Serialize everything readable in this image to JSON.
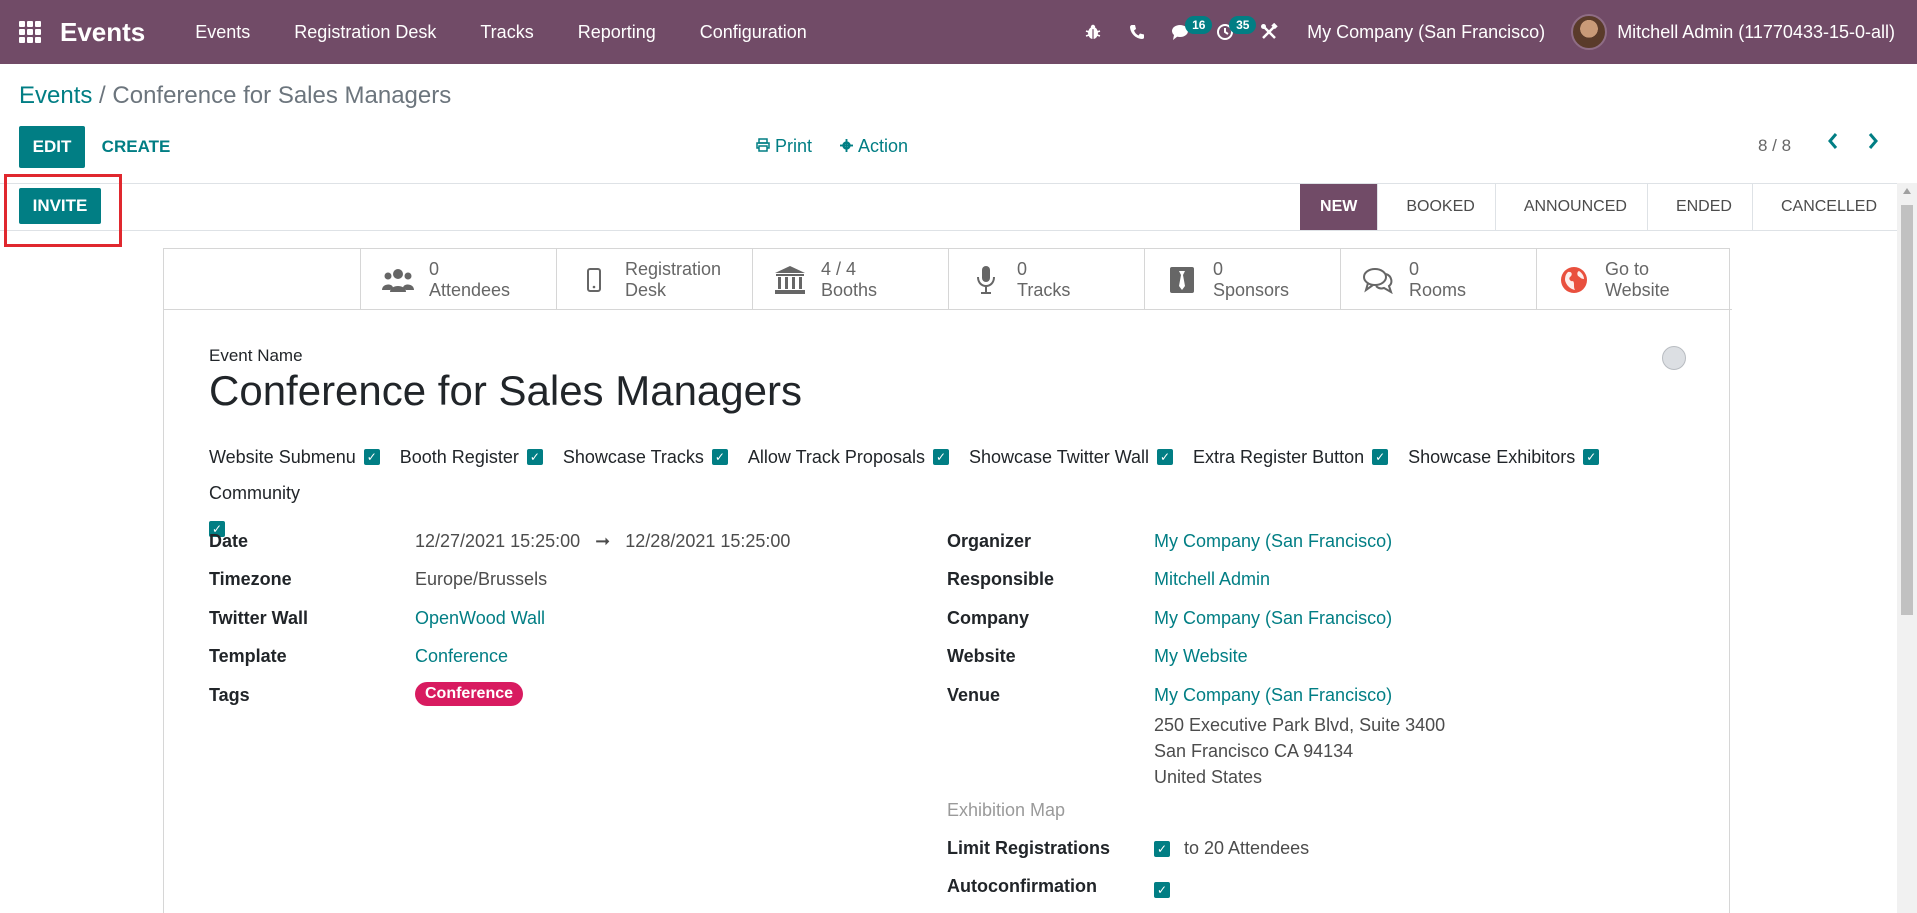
{
  "navbar": {
    "brand": "Events",
    "menu": [
      "Events",
      "Registration Desk",
      "Tracks",
      "Reporting",
      "Configuration"
    ],
    "chat_count": "16",
    "activity_count": "35",
    "company": "My Company (San Francisco)",
    "user": "Mitchell Admin (11770433-15-0-all)"
  },
  "breadcrumb": {
    "parent": "Events",
    "separator": " / ",
    "current": "Conference for Sales Managers"
  },
  "controls": {
    "edit": "EDIT",
    "create": "CREATE",
    "print": "Print",
    "action": "Action",
    "pager": "8 / 8"
  },
  "statusbar": {
    "invite": "INVITE",
    "stages": [
      "NEW",
      "BOOKED",
      "ANNOUNCED",
      "ENDED",
      "CANCELLED"
    ],
    "active_stage": "NEW"
  },
  "smart_buttons": [
    {
      "value": "0",
      "label": "Attendees",
      "icon": "users-icon"
    },
    {
      "value": "Registration",
      "label": "Desk",
      "icon": "mobile-icon"
    },
    {
      "value": "4 / 4",
      "label": "Booths",
      "icon": "bank-icon"
    },
    {
      "value": "0",
      "label": "Tracks",
      "icon": "microphone-icon"
    },
    {
      "value": "0",
      "label": "Sponsors",
      "icon": "sponsor-icon"
    },
    {
      "value": "0",
      "label": "Rooms",
      "icon": "comments-icon"
    },
    {
      "value": "Go to",
      "label": "Website",
      "icon": "globe-icon"
    }
  ],
  "form": {
    "event_name_label": "Event Name",
    "event_name": "Conference for Sales Managers",
    "checkboxes": [
      "Website Submenu",
      "Booth Register",
      "Showcase Tracks",
      "Allow Track Proposals",
      "Showcase Twitter Wall",
      "Extra Register Button",
      "Showcase Exhibitors",
      "Community"
    ],
    "date_label": "Date",
    "date_start": "12/27/2021 15:25:00",
    "date_arrow": "➞",
    "date_end": "12/28/2021 15:25:00",
    "timezone_label": "Timezone",
    "timezone": "Europe/Brussels",
    "twitter_label": "Twitter Wall",
    "twitter": "OpenWood Wall",
    "template_label": "Template",
    "template": "Conference",
    "tags_label": "Tags",
    "tag": "Conference",
    "organizer_label": "Organizer",
    "organizer": "My Company (San Francisco)",
    "responsible_label": "Responsible",
    "responsible": "Mitchell Admin",
    "company_label": "Company",
    "company": "My Company (San Francisco)",
    "website_label": "Website",
    "website": "My Website",
    "venue_label": "Venue",
    "venue_name": "My Company (San Francisco)",
    "venue_line1": "250 Executive Park Blvd, Suite 3400",
    "venue_line2": "San Francisco CA 94134",
    "venue_line3": "United States",
    "exhibition_map_label": "Exhibition Map",
    "limit_label": "Limit Registrations",
    "limit_value": "to 20 Attendees",
    "autoconfirm_label": "Autoconfirmation"
  },
  "colors": {
    "brand": "#714B67",
    "accent": "#017e84",
    "tag": "#d81b60",
    "highlight": "#e0282e"
  }
}
